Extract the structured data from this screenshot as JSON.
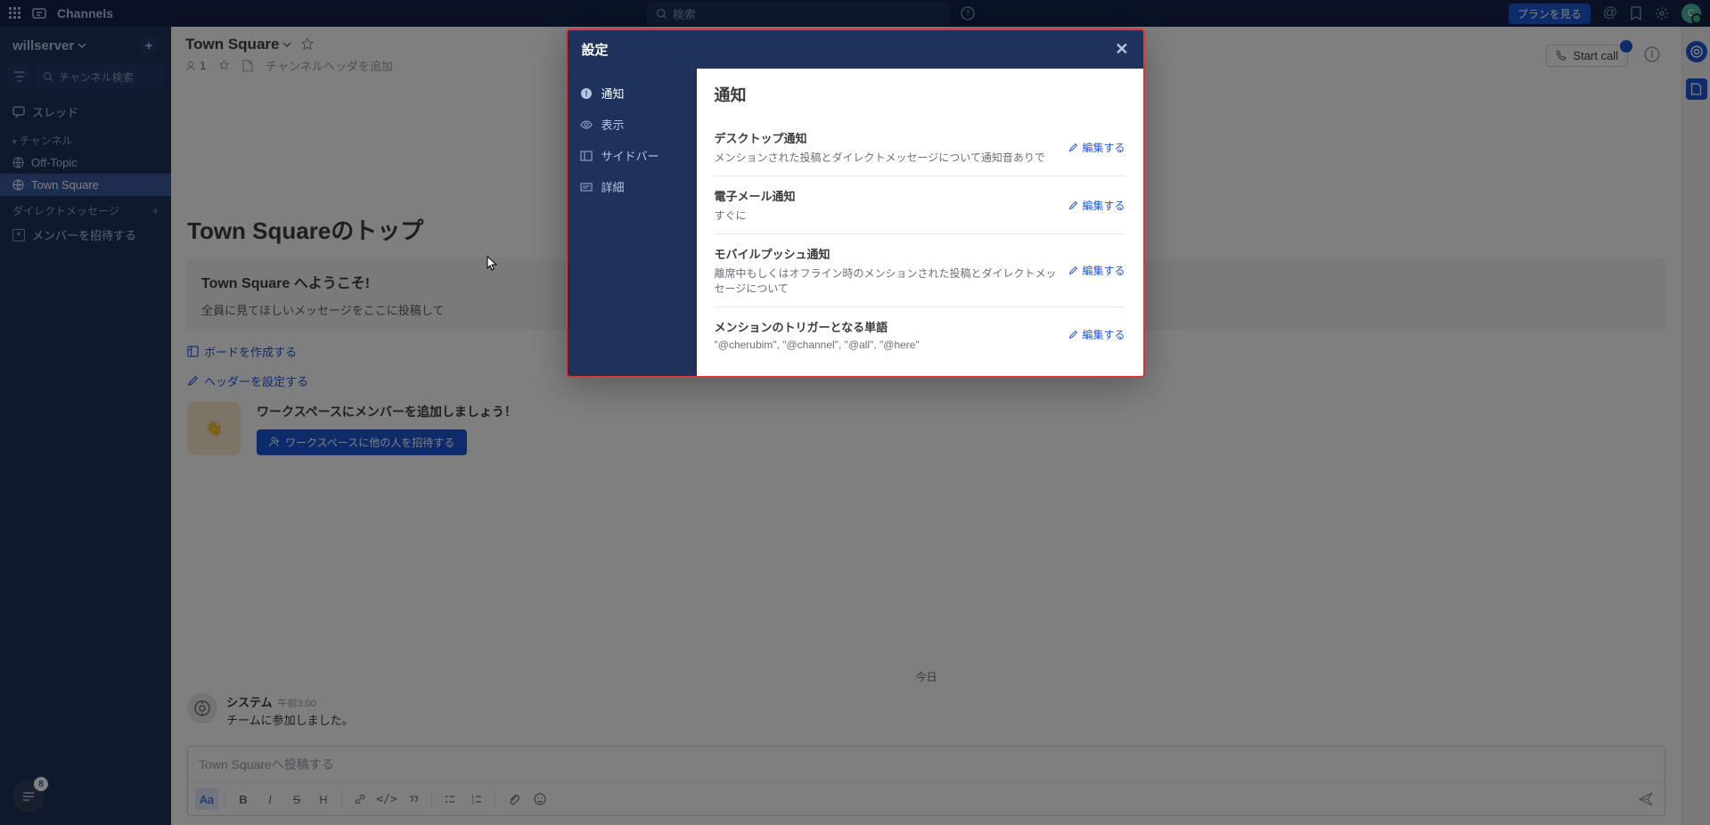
{
  "topbar": {
    "app_name": "Channels",
    "search_placeholder": "検索",
    "plan_button": "プランを見る"
  },
  "sidebar": {
    "team_name": "willserver",
    "channel_search_placeholder": "チャンネル検索",
    "threads_label": "スレッド",
    "channels_section": "チャンネル",
    "channels": [
      {
        "name": "Off-Topic",
        "active": false
      },
      {
        "name": "Town Square",
        "active": true
      }
    ],
    "dm_section": "ダイレクトメッセージ",
    "invite_members_label": "メンバーを招待する"
  },
  "channel": {
    "title": "Town Square",
    "member_count": "1",
    "header_placeholder": "チャンネルヘッダを追加",
    "start_call": "Start call",
    "big_heading": "Town Squareのトップ",
    "welcome_title": "Town Square へようこそ!",
    "welcome_text": "全員に見てほしいメッセージをここに投稿して",
    "create_board": "ボードを作成する",
    "set_header": "ヘッダーを設定する",
    "invite_heading": "ワークスペースにメンバーを追加しましょう！",
    "invite_button": "ワークスペースに他の人を招待する",
    "date_separator": "今日",
    "post_author": "システム",
    "post_time": "午前3:00",
    "post_text": "チームに参加しました。",
    "composer_placeholder": "Town Squareへ投稿する"
  },
  "fab_badge": "8",
  "modal": {
    "title": "設定",
    "nav": [
      {
        "label": "通知",
        "active": true
      },
      {
        "label": "表示",
        "active": false
      },
      {
        "label": "サイドバー",
        "active": false
      },
      {
        "label": "詳細",
        "active": false
      }
    ],
    "section_title": "通知",
    "edit_label": "編集する",
    "settings": [
      {
        "title": "デスクトップ通知",
        "desc": "メンションされた投稿とダイレクトメッセージについて通知音ありで"
      },
      {
        "title": "電子メール通知",
        "desc": "すぐに"
      },
      {
        "title": "モバイルプッシュ通知",
        "desc": "離席中もしくはオフライン時のメンションされた投稿とダイレクトメッセージについて"
      },
      {
        "title": "メンションのトリガーとなる単語",
        "desc": "\"@cherubim\", \"@channel\", \"@all\", \"@here\""
      }
    ]
  }
}
